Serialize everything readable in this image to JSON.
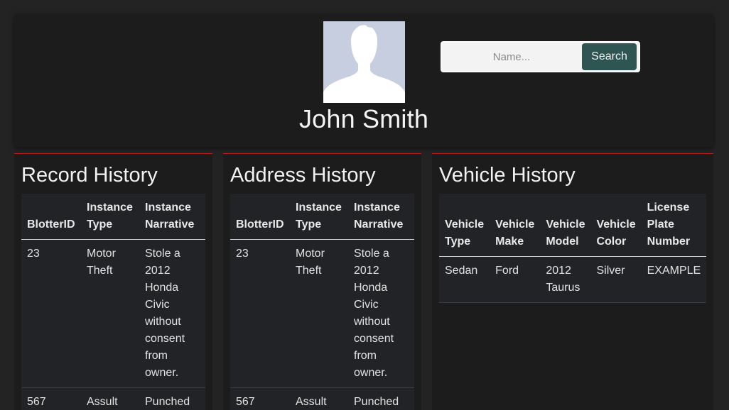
{
  "profile": {
    "name": "John Smith"
  },
  "search": {
    "placeholder": "Name...",
    "button_label": "Search"
  },
  "record_history": {
    "title": "Record History",
    "columns": [
      "BlotterID",
      "Instance Type",
      "Instance Narrative"
    ],
    "rows": [
      [
        "23",
        "Motor Theft",
        "Stole a 2012 Honda Civic without consent from owner."
      ],
      [
        "567",
        "Assult",
        "Punched"
      ]
    ]
  },
  "address_history": {
    "title": "Address History",
    "columns": [
      "BlotterID",
      "Instance Type",
      "Instance Narrative"
    ],
    "rows": [
      [
        "23",
        "Motor Theft",
        "Stole a 2012 Honda Civic without consent from owner."
      ],
      [
        "567",
        "Assult",
        "Punched"
      ]
    ]
  },
  "vehicle_history": {
    "title": "Vehicle History",
    "columns": [
      "Vehicle Type",
      "Vehicle Make",
      "Vehicle Model",
      "Vehicle Color",
      "License Plate Number"
    ],
    "rows": [
      [
        "Sedan",
        "Ford",
        "2012 Taurus",
        "Silver",
        "EXAMPLE"
      ]
    ]
  },
  "colors": {
    "page_bg": "#232323",
    "card_bg": "#1c1c1c",
    "accent_red": "#b0201e",
    "button_bg": "#2f5552",
    "avatar_bg": "#c7cee0"
  }
}
